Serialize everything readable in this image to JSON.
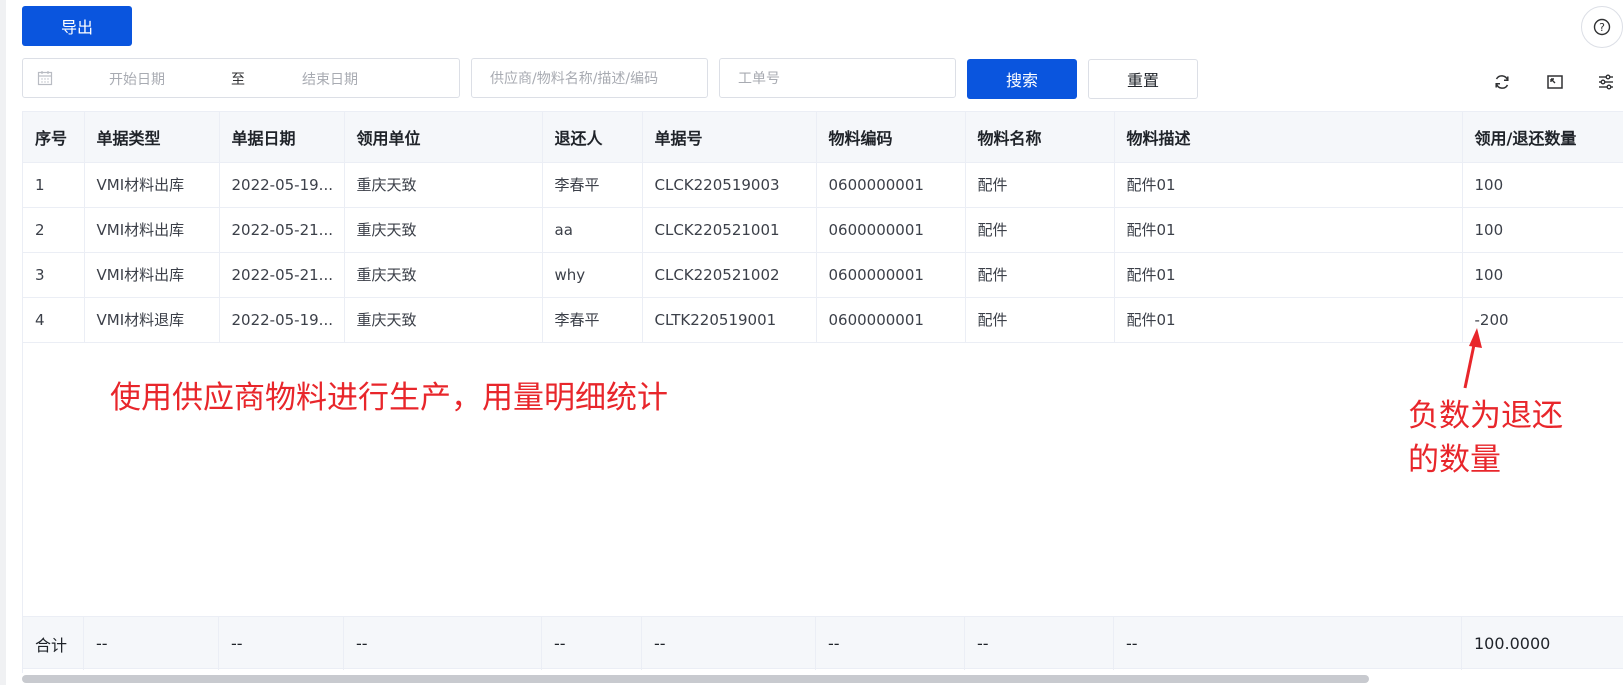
{
  "toolbar": {
    "export_label": "导出",
    "help_symbol": "?"
  },
  "filters": {
    "start_date_placeholder": "开始日期",
    "date_separator": "至",
    "end_date_placeholder": "结束日期",
    "supplier_placeholder": "供应商/物料名称/描述/编码",
    "order_placeholder": "工单号",
    "search_label": "搜索",
    "reset_label": "重置"
  },
  "table": {
    "columns": [
      "序号",
      "单据类型",
      "单据日期",
      "领用单位",
      "退还人",
      "单据号",
      "物料编码",
      "物料名称",
      "物料描述",
      "领用/退还数量"
    ],
    "rows": [
      [
        "1",
        "VMI材料出库",
        "2022-05-19...",
        "重庆天致",
        "李春平",
        "CLCK220519003",
        "0600000001",
        "配件",
        "配件01",
        "100"
      ],
      [
        "2",
        "VMI材料出库",
        "2022-05-21...",
        "重庆天致",
        "aa",
        "CLCK220521001",
        "0600000001",
        "配件",
        "配件01",
        "100"
      ],
      [
        "3",
        "VMI材料出库",
        "2022-05-21...",
        "重庆天致",
        "why",
        "CLCK220521002",
        "0600000001",
        "配件",
        "配件01",
        "100"
      ],
      [
        "4",
        "VMI材料退库",
        "2022-05-19...",
        "重庆天致",
        "李春平",
        "CLTK220519001",
        "0600000001",
        "配件",
        "配件01",
        "-200"
      ]
    ],
    "summary": [
      "合计",
      "--",
      "--",
      "--",
      "--",
      "--",
      "--",
      "--",
      "--",
      "100.0000"
    ]
  },
  "annotations": {
    "main": "使用供应商物料进行生产，用量明细统计",
    "negative_line1": "负数为退还",
    "negative_line2": "的数量",
    "color": "#e8262b"
  },
  "colors": {
    "primary": "#0a55de"
  }
}
